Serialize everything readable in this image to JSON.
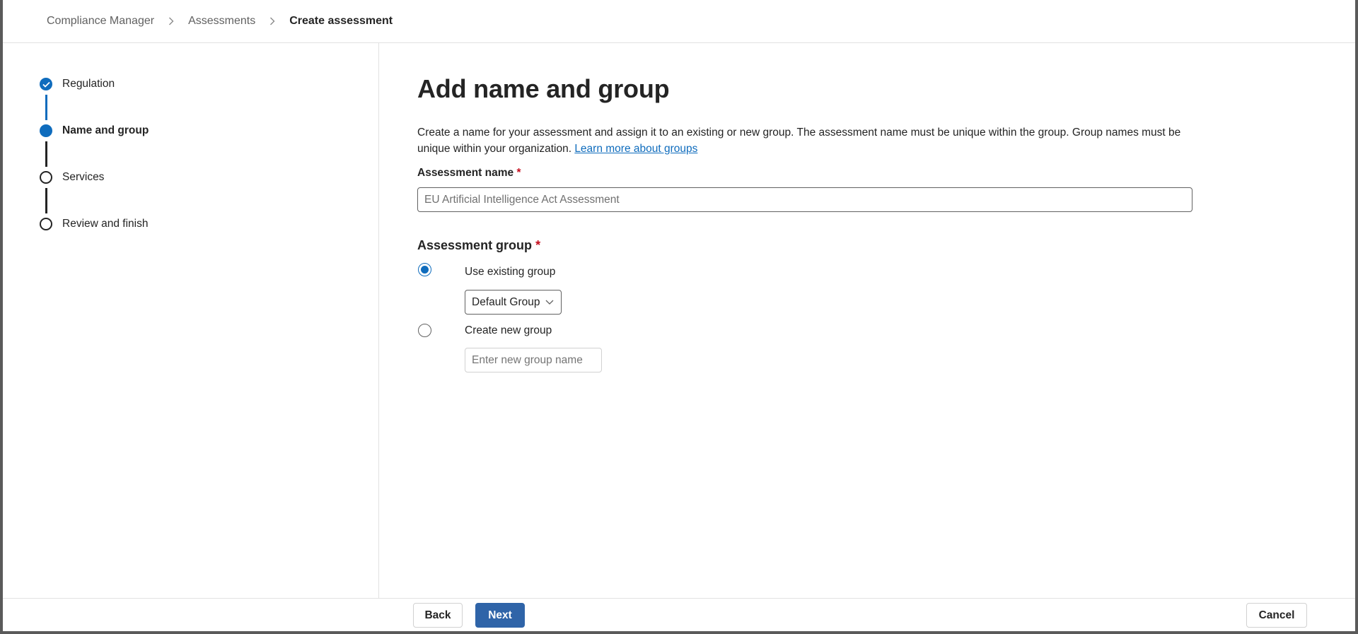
{
  "breadcrumb": {
    "items": [
      "Compliance Manager",
      "Assessments"
    ],
    "current": "Create assessment"
  },
  "steps": [
    {
      "label": "Regulation",
      "state": "done"
    },
    {
      "label": "Name and group",
      "state": "current"
    },
    {
      "label": "Services",
      "state": "todo"
    },
    {
      "label": "Review and finish",
      "state": "todo"
    }
  ],
  "main": {
    "title": "Add name and group",
    "description": "Create a name for your assessment and assign it to an existing or new group. The assessment name must be unique within the group. Group names must be unique within your organization.",
    "learn_more_link": "Learn more about groups",
    "assessment_name_label": "Assessment name",
    "required_marker": "*",
    "assessment_name_value": "EU Artificial Intelligence Act Assessment",
    "assessment_group_label": "Assessment group",
    "options": {
      "existing_label": "Use existing group",
      "existing_selected": true,
      "existing_group_value": "Default Group",
      "new_label": "Create new group",
      "new_selected": false,
      "new_group_placeholder": "Enter new group name"
    }
  },
  "footer": {
    "back_label": "Back",
    "next_label": "Next",
    "cancel_label": "Cancel"
  },
  "colors": {
    "accent": "#0f6cbd",
    "primary_button": "#2f64a8",
    "required": "#c50f1f"
  }
}
